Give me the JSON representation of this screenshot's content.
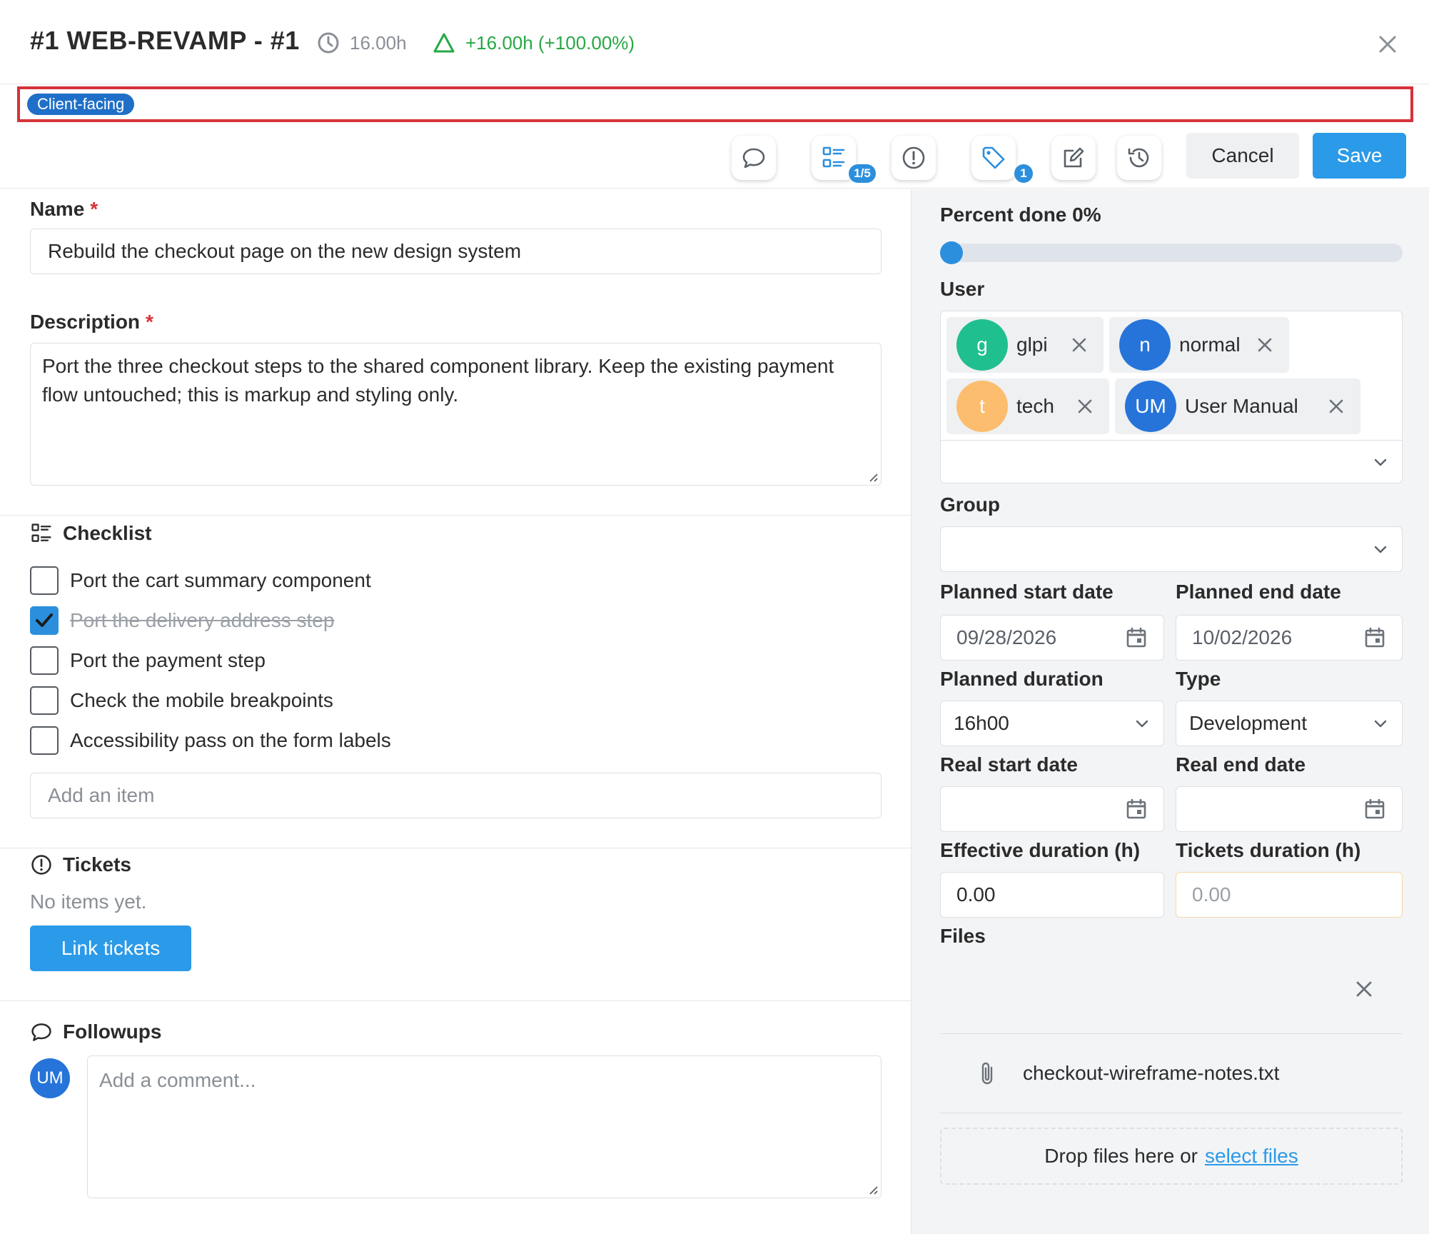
{
  "header": {
    "title": "#1 WEB-REVAMP - #1",
    "planned_time": "16.00h",
    "delta": "+16.00h (+100.00%)"
  },
  "tags": [
    {
      "label": "Client-facing"
    }
  ],
  "toolbar": {
    "checklist_badge": "1/5",
    "tags_badge": "1",
    "cancel_label": "Cancel",
    "save_label": "Save"
  },
  "form": {
    "name_label": "Name",
    "name_value": "Rebuild the checkout page on the new design system",
    "description_label": "Description",
    "description_value": "Port the three checkout steps to the shared component library. Keep the existing payment flow untouched; this is markup and styling only.",
    "required_mark": "*"
  },
  "checklist": {
    "title": "Checklist",
    "items": [
      {
        "label": "Port the cart summary component",
        "done": false
      },
      {
        "label": "Port the delivery address step",
        "done": true
      },
      {
        "label": "Port the payment step",
        "done": false
      },
      {
        "label": "Check the mobile breakpoints",
        "done": false
      },
      {
        "label": "Accessibility pass on the form labels",
        "done": false
      }
    ],
    "add_placeholder": "Add an item"
  },
  "tickets": {
    "title": "Tickets",
    "empty_text": "No items yet.",
    "link_button": "Link tickets"
  },
  "followups": {
    "title": "Followups",
    "avatar_initials": "UM",
    "comment_placeholder": "Add a comment..."
  },
  "sidebar": {
    "percent_label": "Percent done 0%",
    "percent_value": 0,
    "user_label": "User",
    "users": [
      {
        "initial": "g",
        "name": "glpi",
        "color": "#1fbf8f"
      },
      {
        "initial": "n",
        "name": "normal",
        "color": "#2674d9"
      },
      {
        "initial": "t",
        "name": "tech",
        "color": "#fcbd6e"
      },
      {
        "initial": "UM",
        "name": "User Manual",
        "color": "#2674d9"
      }
    ],
    "group_label": "Group",
    "planned_start_label": "Planned start date",
    "planned_start_value": "09/28/2026",
    "planned_end_label": "Planned end date",
    "planned_end_value": "10/02/2026",
    "planned_duration_label": "Planned duration",
    "planned_duration_value": "16h00",
    "type_label": "Type",
    "type_value": "Development",
    "real_start_label": "Real start date",
    "real_end_label": "Real end date",
    "effective_duration_label": "Effective duration (h)",
    "effective_duration_value": "0.00",
    "tickets_duration_label": "Tickets duration (h)",
    "tickets_duration_value": "0.00",
    "files_label": "Files",
    "file_name": "checkout-wireframe-notes.txt",
    "drop_text": "Drop files here or",
    "drop_link": "select files"
  },
  "colors": {
    "accent": "#2b9ae8",
    "tag": "#1f6fc8",
    "success": "#27a844",
    "required": "#d6323a",
    "highlight_border": "#d6323a"
  }
}
